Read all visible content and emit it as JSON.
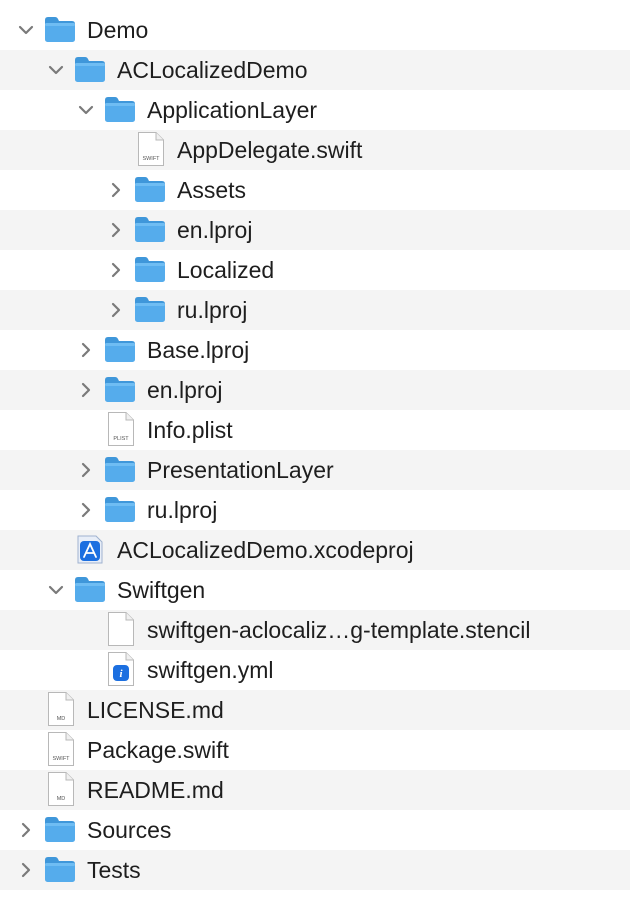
{
  "finder_tree": {
    "items": [
      {
        "label": "Demo",
        "kind": "folder",
        "depth": 0,
        "disclosure": "expanded",
        "icon": "folder-icon"
      },
      {
        "label": "ACLocalizedDemo",
        "kind": "folder",
        "depth": 1,
        "disclosure": "expanded",
        "icon": "folder-icon"
      },
      {
        "label": "ApplicationLayer",
        "kind": "folder",
        "depth": 2,
        "disclosure": "expanded",
        "icon": "folder-icon"
      },
      {
        "label": "AppDelegate.swift",
        "kind": "file",
        "depth": 3,
        "disclosure": "none",
        "icon": "swift-file-icon",
        "badge": "SWIFT"
      },
      {
        "label": "Assets",
        "kind": "folder",
        "depth": 3,
        "disclosure": "collapsed",
        "icon": "folder-icon"
      },
      {
        "label": "en.lproj",
        "kind": "folder",
        "depth": 3,
        "disclosure": "collapsed",
        "icon": "folder-icon"
      },
      {
        "label": "Localized",
        "kind": "folder",
        "depth": 3,
        "disclosure": "collapsed",
        "icon": "folder-icon"
      },
      {
        "label": "ru.lproj",
        "kind": "folder",
        "depth": 3,
        "disclosure": "collapsed",
        "icon": "folder-icon"
      },
      {
        "label": "Base.lproj",
        "kind": "folder",
        "depth": 2,
        "disclosure": "collapsed",
        "icon": "folder-icon"
      },
      {
        "label": "en.lproj",
        "kind": "folder",
        "depth": 2,
        "disclosure": "collapsed",
        "icon": "folder-icon"
      },
      {
        "label": "Info.plist",
        "kind": "file",
        "depth": 2,
        "disclosure": "none",
        "icon": "plist-file-icon",
        "badge": "PLIST"
      },
      {
        "label": "PresentationLayer",
        "kind": "folder",
        "depth": 2,
        "disclosure": "collapsed",
        "icon": "folder-icon"
      },
      {
        "label": "ru.lproj",
        "kind": "folder",
        "depth": 2,
        "disclosure": "collapsed",
        "icon": "folder-icon"
      },
      {
        "label": "ACLocalizedDemo.xcodeproj",
        "kind": "xcodeproj",
        "depth": 1,
        "disclosure": "none",
        "icon": "xcodeproj-icon"
      },
      {
        "label": "Swiftgen",
        "kind": "folder",
        "depth": 1,
        "disclosure": "expanded",
        "icon": "folder-icon"
      },
      {
        "label": "swiftgen-aclocaliz…g-template.stencil",
        "kind": "file",
        "depth": 2,
        "disclosure": "none",
        "icon": "blank-file-icon",
        "badge": ""
      },
      {
        "label": "swiftgen.yml",
        "kind": "yml",
        "depth": 2,
        "disclosure": "none",
        "icon": "yml-file-icon"
      },
      {
        "label": "LICENSE.md",
        "kind": "file",
        "depth": 0,
        "disclosure": "none",
        "icon": "md-file-icon",
        "badge": "MD"
      },
      {
        "label": "Package.swift",
        "kind": "file",
        "depth": 0,
        "disclosure": "none",
        "icon": "swift-file-icon",
        "badge": "SWIFT"
      },
      {
        "label": "README.md",
        "kind": "file",
        "depth": 0,
        "disclosure": "none",
        "icon": "md-file-icon",
        "badge": "MD"
      },
      {
        "label": "Sources",
        "kind": "folder",
        "depth": 0,
        "disclosure": "collapsed",
        "icon": "folder-icon"
      },
      {
        "label": "Tests",
        "kind": "folder",
        "depth": 0,
        "disclosure": "collapsed",
        "icon": "folder-icon"
      }
    ]
  },
  "colors": {
    "folder_body": "#55acec",
    "folder_tab": "#3f97da",
    "folder_front": "#6fbdf3",
    "text": "#1e1e1e",
    "alt_row": "#f4f4f4",
    "chevron": "#7a7a7a",
    "xcode_blue": "#1c6fe0"
  }
}
